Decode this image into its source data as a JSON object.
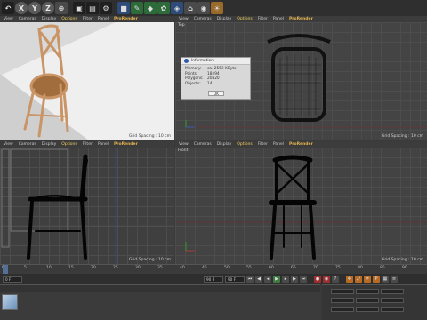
{
  "toolbar": {
    "axis_buttons": [
      "X",
      "Y",
      "Z"
    ]
  },
  "viewport_menu": {
    "items": [
      "View",
      "Cameras",
      "Display",
      "Options",
      "Filter",
      "Panel"
    ],
    "renderer": "ProRender"
  },
  "viewports": {
    "perspective": {
      "grid_spacing": "Grid Spacing : 10 cm"
    },
    "top": {
      "name": "Top",
      "grid_spacing": "Grid Spacing : 10 cm"
    },
    "right": {
      "grid_spacing": "Grid Spacing : 10 cm"
    },
    "front": {
      "name": "Front",
      "grid_spacing": "Grid Spacing : 10 cm"
    }
  },
  "info_dialog": {
    "title": "Information",
    "rows": [
      {
        "key": "Memory:",
        "value": "ca. 2559 KByte"
      },
      {
        "key": "Points:",
        "value": "18494"
      },
      {
        "key": "Polygons:",
        "value": "20820"
      },
      {
        "key": "Objects:",
        "value": "14"
      }
    ],
    "ok_label": "OK"
  },
  "timeline": {
    "ticks": [
      "0",
      "5",
      "10",
      "15",
      "20",
      "25",
      "30",
      "35",
      "40",
      "45",
      "50",
      "55",
      "60",
      "65",
      "70",
      "75",
      "80",
      "85",
      "90"
    ]
  },
  "transport": {
    "current_frame": "0 F",
    "end_frame": "90 F",
    "fps_field": "90 F"
  },
  "colors": {
    "accent": "#f2d060",
    "renderer": "#e3b24e",
    "chair_wood": "#d8a878",
    "seat": "#9a6a3a",
    "floor": "#e8e8e8"
  }
}
